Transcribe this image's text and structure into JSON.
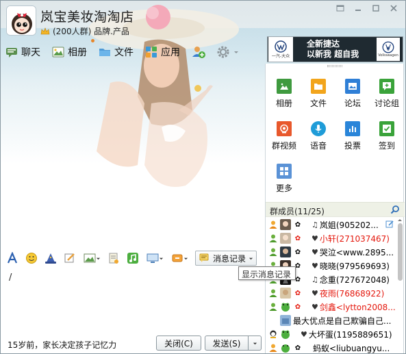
{
  "group": {
    "name": "岚宝美妆淘淘店",
    "subtitle": "(200人群) 品牌.产品"
  },
  "toolbar": {
    "items": [
      {
        "label": "聊天",
        "icon": "chat-icon"
      },
      {
        "label": "相册",
        "icon": "photo-album-icon"
      },
      {
        "label": "文件",
        "icon": "folder-icon"
      },
      {
        "label": "应用",
        "icon": "apps-grid-icon"
      }
    ],
    "add_member_icon": "add-member-icon",
    "settings_icon": "gear-icon"
  },
  "ad": {
    "brand_left": "一汽-大众",
    "line1": "全新捷达",
    "line2": "以新我 超自我",
    "brand_right": "Volkswagen"
  },
  "apps": [
    {
      "label": "相册",
      "color": "#3f9a3f",
      "icon": "photo-icon"
    },
    {
      "label": "文件",
      "color": "#f2a51c",
      "icon": "folder-icon"
    },
    {
      "label": "论坛",
      "color": "#2f7fd6",
      "icon": "forum-icon"
    },
    {
      "label": "讨论组",
      "color": "#3aa33a",
      "icon": "discussion-group-icon"
    },
    {
      "label": "群视频",
      "color": "#e8582c",
      "icon": "group-video-icon"
    },
    {
      "label": "语音",
      "color": "#1f9cd8",
      "icon": "voice-icon"
    },
    {
      "label": "投票",
      "color": "#2a85d9",
      "icon": "vote-icon"
    },
    {
      "label": "签到",
      "color": "#3aa33a",
      "icon": "check-in-icon"
    },
    {
      "label": "更多",
      "color": "#5a92d6",
      "icon": "more-apps-icon"
    }
  ],
  "members": {
    "title": "群成员(11/25)",
    "list": [
      {
        "name": "岚姐(905202...",
        "red": false,
        "prefix": "♫"
      },
      {
        "name": "小轩(271037467)",
        "red": true,
        "prefix": "♥"
      },
      {
        "name": "哭泣<www.2895...",
        "red": false,
        "prefix": "♥"
      },
      {
        "name": "晓晓(979569693)",
        "red": false,
        "prefix": "♥"
      },
      {
        "name": "念重(727672048)",
        "red": false,
        "prefix": "♫"
      },
      {
        "name": "夜雨(76868922)",
        "red": true,
        "prefix": "♥"
      },
      {
        "name": "剑鑫<lytton2008...",
        "red": true,
        "prefix": "♥"
      },
      {
        "name": "最大优点是自己欺骗自己...",
        "red": false,
        "prefix": ""
      },
      {
        "name": "大坏蛋(1195889651)",
        "red": false,
        "prefix": "♥"
      },
      {
        "name": "蚂蚁<liubuangyu...",
        "red": false,
        "prefix": ""
      }
    ]
  },
  "input": {
    "history_label": "消息记录",
    "tooltip": "显示消息记录",
    "caret": "/"
  },
  "footer": {
    "note": "15岁前，家长决定孩子记忆力",
    "close_label": "关闭(C)",
    "send_label": "发送(S)"
  }
}
